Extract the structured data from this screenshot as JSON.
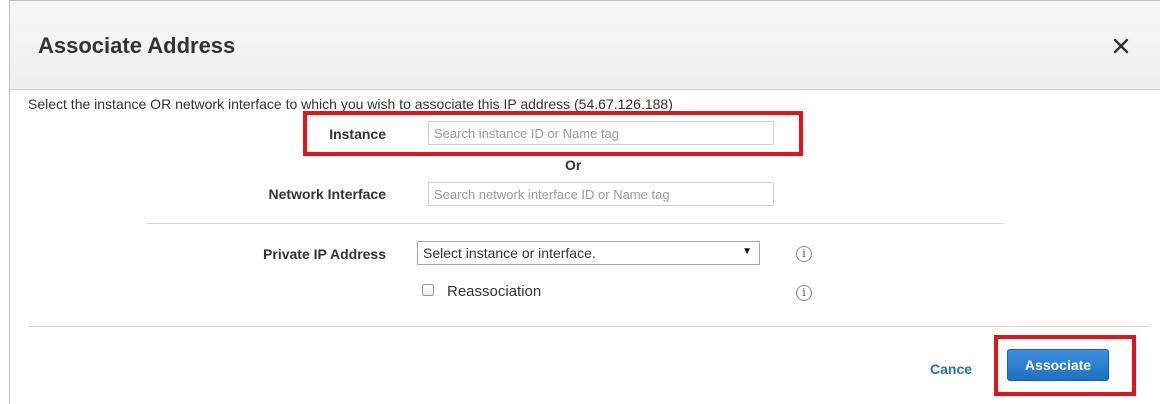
{
  "dialog": {
    "title": "Associate Address",
    "close_icon": "close-icon",
    "intro_text": "Select the instance OR network interface to which you wish to associate this IP address (54.67.126.188)"
  },
  "form": {
    "instance": {
      "label": "Instance",
      "placeholder": "Search instance ID or Name tag",
      "value": ""
    },
    "or_text": "Or",
    "network_interface": {
      "label": "Network Interface",
      "placeholder": "Search network interface ID or Name tag",
      "value": ""
    },
    "private_ip": {
      "label": "Private IP Address",
      "selected_option": "Select instance or interface.",
      "info_icon": "info-icon"
    },
    "reassociation": {
      "label": "Reassociation",
      "checked": false,
      "info_icon": "info-icon"
    }
  },
  "footer": {
    "cancel_label": "Cance",
    "associate_label": "Associate"
  },
  "colors": {
    "link": "#1e73be",
    "primary_button": "#2a7ad2",
    "highlight": "#e1141c"
  }
}
